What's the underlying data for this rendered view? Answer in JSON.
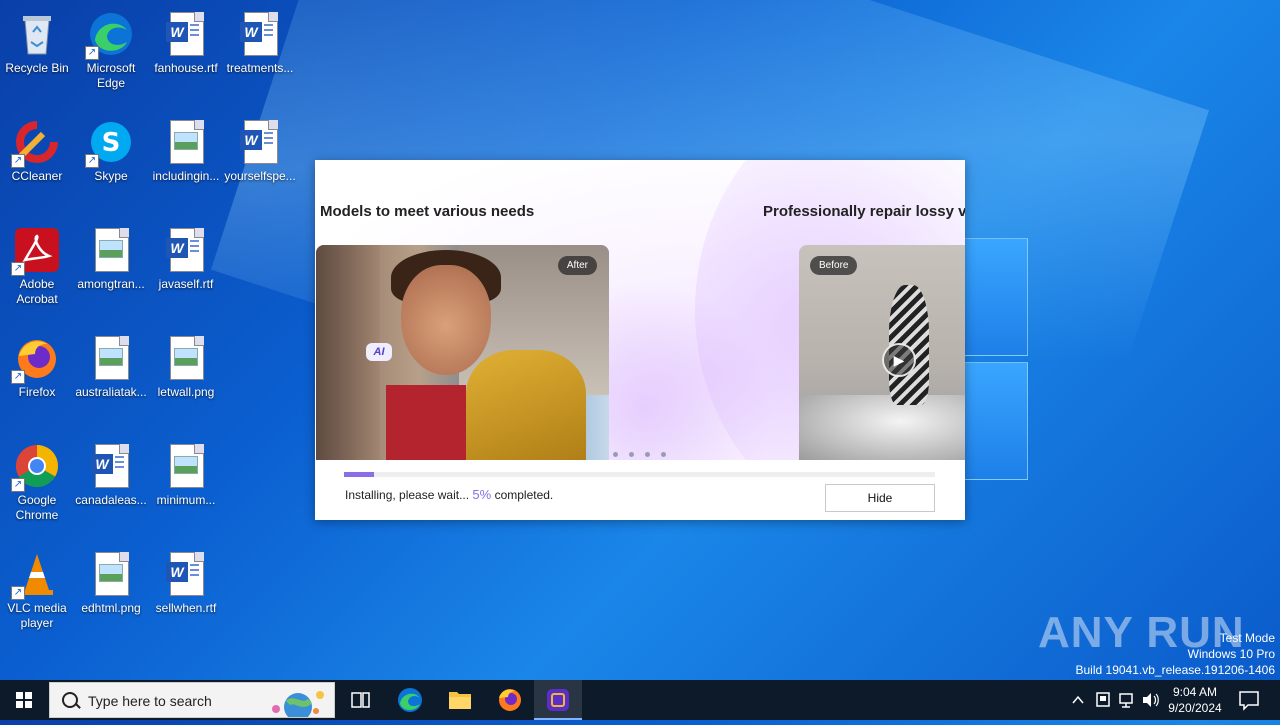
{
  "desktop": {
    "icons": [
      {
        "label": "Recycle Bin"
      },
      {
        "label": "Microsoft Edge"
      },
      {
        "label": "fanhouse.rtf"
      },
      {
        "label": "treatments..."
      },
      {
        "label": "CCleaner"
      },
      {
        "label": "Skype"
      },
      {
        "label": "includingin..."
      },
      {
        "label": "yourselfspe..."
      },
      {
        "label": "Adobe Acrobat"
      },
      {
        "label": "amongtran..."
      },
      {
        "label": "javaself.rtf"
      },
      {
        "label": "Firefox"
      },
      {
        "label": "australiatak..."
      },
      {
        "label": "letwall.png"
      },
      {
        "label": "Google Chrome"
      },
      {
        "label": "canadaleas..."
      },
      {
        "label": "minimum..."
      },
      {
        "label": "VLC media player"
      },
      {
        "label": "edhtml.png"
      },
      {
        "label": "sellwhen.rtf"
      }
    ]
  },
  "installer": {
    "heading_left": "Models to meet various needs",
    "heading_right": "Professionally repair lossy v",
    "tag_after": "After",
    "tag_before": "Before",
    "ai_badge": "AI",
    "progress_percent": 5,
    "status_prefix": "Installing, please wait...",
    "status_percent": "5%",
    "status_suffix": "completed.",
    "hide_label": "Hide",
    "accent_color": "#8a6ee6"
  },
  "watermark": {
    "brand": "ANY RUN",
    "line1": "Test Mode",
    "line2": "Windows 10 Pro",
    "line3": "Build 19041.vb_release.191206-1406"
  },
  "taskbar": {
    "search_placeholder": "Type here to search",
    "time": "9:04 AM",
    "date": "9/20/2024"
  }
}
